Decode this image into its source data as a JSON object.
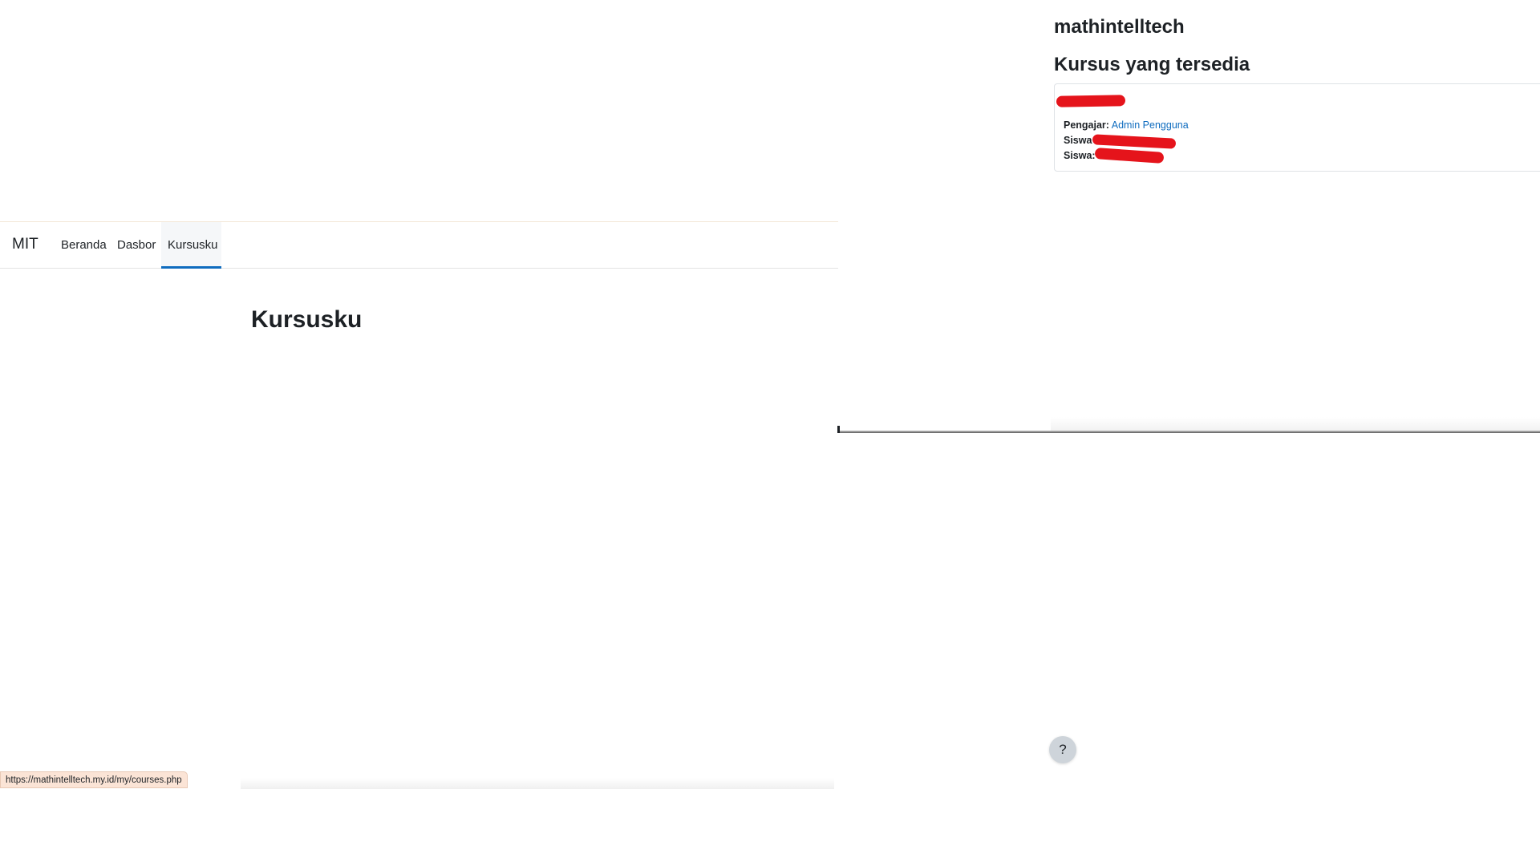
{
  "navbar": {
    "brand": "MIT",
    "items": [
      {
        "label": "Beranda"
      },
      {
        "label": "Dasbor"
      },
      {
        "label": "Kursusku",
        "active": true
      }
    ]
  },
  "main": {
    "heading": "Kursusku"
  },
  "status_bar": {
    "url": "https://mathintelltech.my.id/my/courses.php"
  },
  "frontpage": {
    "site_name": "mathintelltech",
    "section_title": "Kursus yang tersedia",
    "course_card": {
      "teacher_label": "Pengajar:",
      "teacher_name": "Admin Pengguna",
      "student_label_1": "Siswa",
      "student_label_2": "Siswa:"
    }
  },
  "help": {
    "label": "?"
  },
  "colors": {
    "link": "#0f6cbf",
    "active_tab_underline": "#0f6cbf",
    "redaction": "#e5141b",
    "status_bar_bg": "#fbe4d6"
  }
}
